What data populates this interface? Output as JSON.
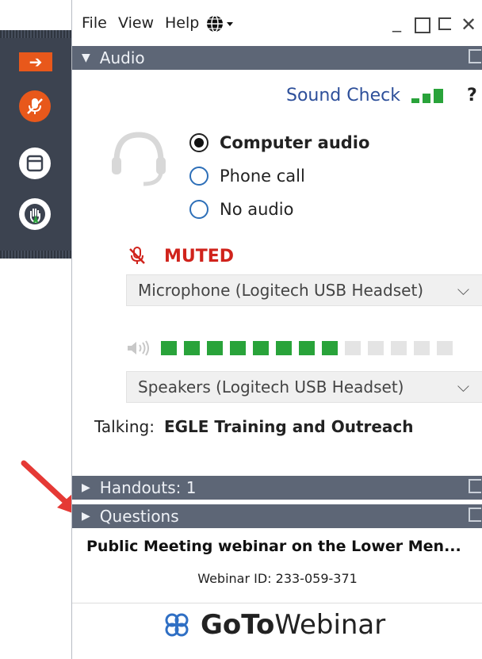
{
  "menu": {
    "file": "File",
    "view": "View",
    "help": "Help"
  },
  "audio_section": {
    "title": "Audio"
  },
  "sound_check": {
    "label": "Sound Check",
    "help": "?"
  },
  "audio_options": [
    {
      "label": "Computer audio",
      "selected": true
    },
    {
      "label": "Phone call",
      "selected": false
    },
    {
      "label": "No audio",
      "selected": false
    }
  ],
  "mute_status": {
    "label": "MUTED"
  },
  "microphone": {
    "value": "Microphone (Logitech USB Headset)"
  },
  "speaker_level": {
    "level": 0.62
  },
  "speakers": {
    "value": "Speakers (Logitech USB Headset)"
  },
  "talking": {
    "label": "Talking:",
    "name": "EGLE Training and Outreach"
  },
  "handouts_section": {
    "title": "Handouts: 1"
  },
  "questions_section": {
    "title": "Questions"
  },
  "webinar": {
    "title": "Public Meeting webinar on the Lower Men...",
    "id_text": "Webinar ID: 233-059-371"
  },
  "brand": {
    "go": "GoTo",
    "rest": "Webinar"
  },
  "colors": {
    "accent_orange": "#e8581b",
    "muted_red": "#d0231c",
    "level_green": "#29a33a",
    "bar_gray": "#5d6676",
    "link_blue": "#2d4f9a"
  }
}
